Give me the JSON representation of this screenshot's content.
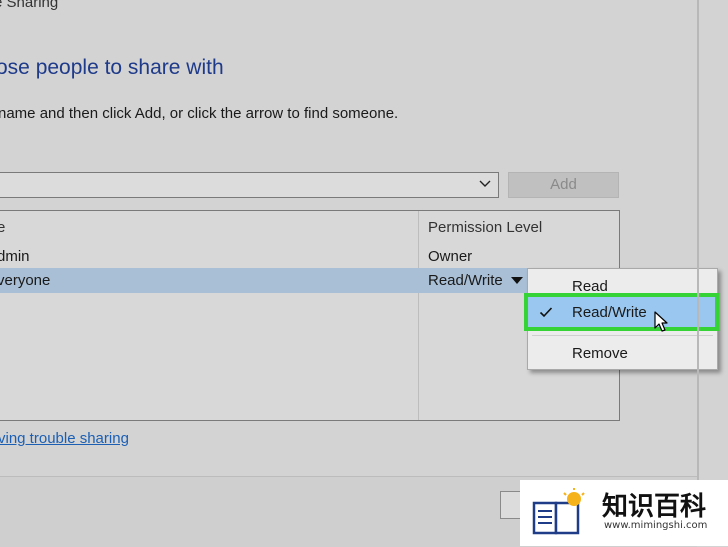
{
  "window": {
    "title": "e Sharing"
  },
  "heading": "ose people to share with",
  "instruction": " name and then click Add, or click the arrow to find someone.",
  "add_button": {
    "label": "Add"
  },
  "list": {
    "columns": {
      "name": "e",
      "permission": "Permission Level"
    },
    "rows": [
      {
        "name": "dmin",
        "permission": "Owner"
      },
      {
        "name": "veryone",
        "permission": "Read/Write"
      }
    ]
  },
  "menu": {
    "items": [
      {
        "label": "Read"
      },
      {
        "label": "Read/Write",
        "checked": true
      },
      {
        "label": "Remove"
      }
    ]
  },
  "help_link": "ving trouble sharing",
  "watermark": {
    "brand": "知识百科",
    "url": "www.mimingshi.com"
  },
  "colors": {
    "selected_row": "#a9bfd6",
    "menu_highlight": "#99c7ef",
    "highlight_outline": "#35d335",
    "heading": "#1e3a8a",
    "link": "#1b5fb4"
  }
}
